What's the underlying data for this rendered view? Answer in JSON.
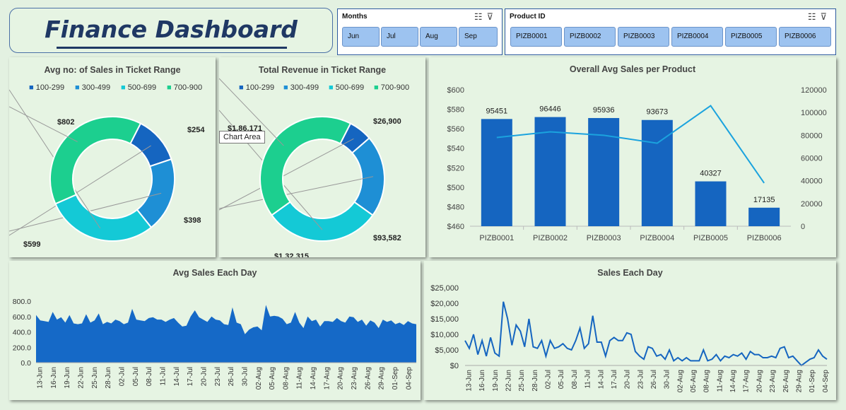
{
  "header": {
    "title": "Finance Dashboard"
  },
  "slicers": {
    "months": {
      "title": "Months",
      "items": [
        "Jun",
        "Jul",
        "Aug",
        "Sep"
      ]
    },
    "product": {
      "title": "Product ID",
      "items": [
        "PIZB0001",
        "PIZB0002",
        "PIZB0003",
        "PIZB0004",
        "PIZB0005",
        "PIZB0006"
      ]
    }
  },
  "tooltip": {
    "text": "Chart Area"
  },
  "colors": {
    "c1": "#1565c0",
    "c2": "#1e8fd5",
    "c3": "#14c9d6",
    "c4": "#1ccf8f",
    "line": "#1ba3de",
    "bar": "#1565c0",
    "area": "#1569c7",
    "title": "#1f3864"
  },
  "chart_data": [
    {
      "type": "pie",
      "title": "Avg no: of Sales in Ticket Range",
      "legend": [
        "100-299",
        "300-499",
        "500-699",
        "700-900"
      ],
      "values": [
        254,
        398,
        599,
        802
      ],
      "labels": [
        "$254",
        "$398",
        "$599",
        "$802"
      ]
    },
    {
      "type": "pie",
      "title": "Total Revenue in Ticket Range",
      "legend": [
        "100-299",
        "300-499",
        "500-699",
        "700-900"
      ],
      "values": [
        26900,
        93582,
        132315,
        186171
      ],
      "labels": [
        "$26,900",
        "$93,582",
        "$1,32,315",
        "$1,86,171"
      ]
    },
    {
      "type": "bar",
      "title": "Overall  Avg Sales per Product",
      "categories": [
        "PIZB0001",
        "PIZB0002",
        "PIZB0003",
        "PIZB0004",
        "PIZB0005",
        "PIZB0006"
      ],
      "series": [
        {
          "values": [
            570,
            572,
            571,
            569,
            506,
            479
          ]
        },
        {
          "values": [
            95451,
            96446,
            95936,
            93673,
            40327,
            17135
          ]
        }
      ],
      "bar_labels": [
        "95451",
        "96446",
        "95936",
        "93673",
        "40327",
        "17135"
      ],
      "line_values": [
        78000,
        83000,
        80000,
        73000,
        106000,
        38000
      ],
      "ylim": [
        460,
        600
      ],
      "y_ticks": [
        "$460",
        "$480",
        "$500",
        "$520",
        "$540",
        "$560",
        "$580",
        "$600"
      ],
      "y2lim": [
        0,
        120000
      ],
      "y2_ticks": [
        "0",
        "20000",
        "40000",
        "60000",
        "80000",
        "100000",
        "120000"
      ]
    },
    {
      "type": "area",
      "title": "Avg Sales Each Day",
      "x": [
        "13-Jun",
        "16-Jun",
        "19-Jun",
        "22-Jun",
        "25-Jun",
        "28-Jun",
        "02-Jul",
        "05-Jul",
        "08-Jul",
        "11-Jul",
        "14-Jul",
        "17-Jul",
        "20-Jul",
        "23-Jul",
        "26-Jul",
        "30-Jul",
        "02-Aug",
        "05-Aug",
        "08-Aug",
        "11-Aug",
        "14-Aug",
        "17-Aug",
        "20-Aug",
        "23-Aug",
        "26-Aug",
        "29-Aug",
        "01-Sep",
        "04-Sep"
      ],
      "values": [
        620,
        550,
        540,
        530,
        660,
        560,
        590,
        520,
        620,
        510,
        500,
        510,
        630,
        520,
        550,
        640,
        500,
        530,
        510,
        560,
        540,
        500,
        520,
        700,
        560,
        550,
        540,
        580,
        590,
        560,
        560,
        530,
        560,
        580,
        520,
        470,
        480,
        600,
        680,
        590,
        560,
        530,
        600,
        560,
        550,
        500,
        490,
        720,
        520,
        500,
        370,
        430,
        460,
        470,
        420,
        750,
        600,
        610,
        600,
        570,
        500,
        520,
        660,
        520,
        450,
        600,
        540,
        560,
        470,
        540,
        540,
        530,
        580,
        540,
        520,
        600,
        590,
        530,
        560,
        480,
        550,
        520,
        450,
        560,
        530,
        550,
        500,
        520,
        490,
        540,
        510,
        500
      ],
      "ylim": [
        0,
        800
      ],
      "y_ticks": [
        "0.0",
        "200.0",
        "400.0",
        "600.0",
        "800.0"
      ]
    },
    {
      "type": "line",
      "title": "Sales Each Day",
      "x": [
        "13-Jun",
        "16-Jun",
        "19-Jun",
        "22-Jun",
        "25-Jun",
        "28-Jun",
        "02-Jul",
        "05-Jul",
        "08-Jul",
        "11-Jul",
        "14-Jul",
        "17-Jul",
        "20-Jul",
        "23-Jul",
        "26-Jul",
        "30-Jul",
        "02-Aug",
        "05-Aug",
        "08-Aug",
        "11-Aug",
        "14-Aug",
        "17-Aug",
        "20-Aug",
        "23-Aug",
        "26-Aug",
        "29-Aug",
        "01-Sep",
        "04-Sep"
      ],
      "values": [
        8000,
        5500,
        10000,
        3500,
        8000,
        3000,
        9000,
        4000,
        3000,
        20500,
        15000,
        6500,
        13000,
        11000,
        6000,
        15000,
        6000,
        5500,
        8000,
        3000,
        8000,
        5500,
        6000,
        7000,
        5500,
        5000,
        8000,
        12000,
        5500,
        7000,
        16000,
        7500,
        7500,
        3000,
        8000,
        9000,
        8000,
        8000,
        10500,
        10000,
        4500,
        3000,
        2000,
        6000,
        5500,
        3000,
        3500,
        2000,
        5000,
        1500,
        2500,
        1500,
        2500,
        1500,
        1500,
        1500,
        5000,
        1500,
        2000,
        3500,
        1500,
        3000,
        2500,
        3500,
        3000,
        4000,
        2000,
        4500,
        3500,
        3500,
        2500,
        2500,
        3000,
        2500,
        5500,
        6000,
        2500,
        3000,
        1500,
        0,
        1000,
        2000,
        2500,
        5000,
        3000,
        2000
      ],
      "ylim": [
        0,
        25000
      ],
      "y_ticks": [
        "$0",
        "$5,000",
        "$10,000",
        "$15,000",
        "$20,000",
        "$25,000"
      ]
    }
  ]
}
